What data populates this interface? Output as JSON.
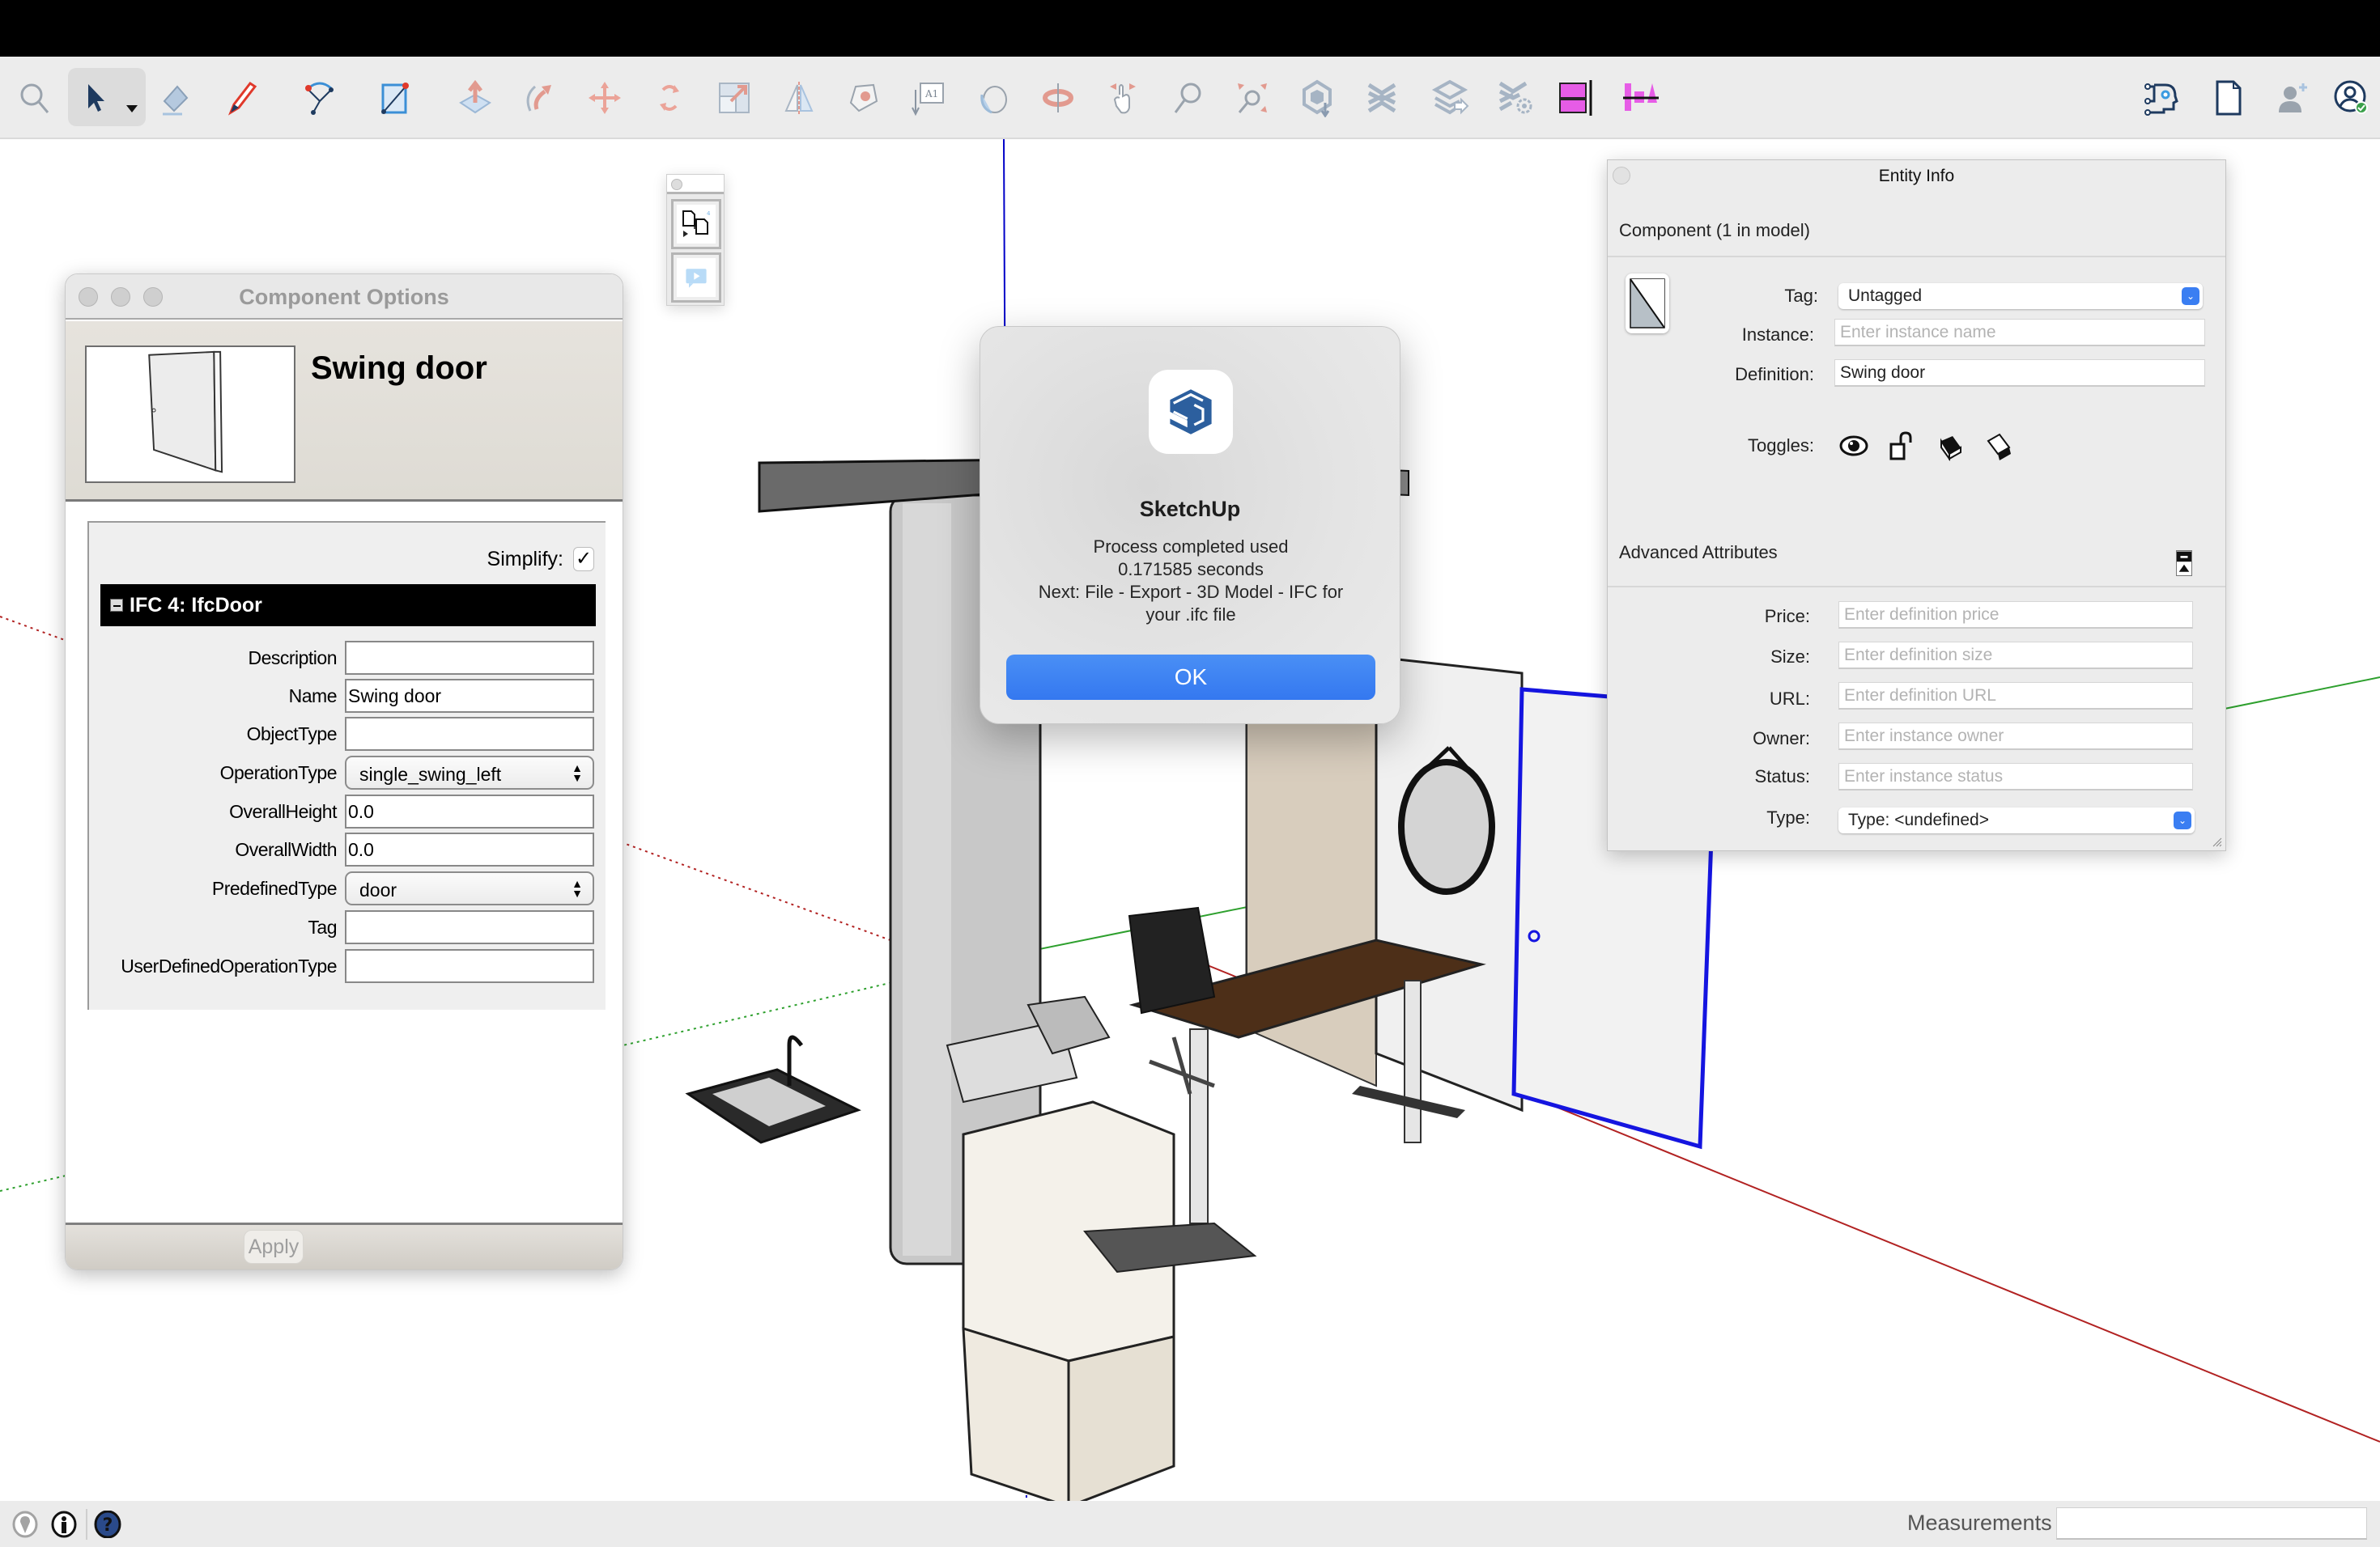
{
  "app": {
    "name": "SketchUp"
  },
  "toolbar": {
    "tools": [
      {
        "name": "search",
        "icon": "magnifier-icon"
      },
      {
        "name": "select",
        "icon": "select-arrow-icon",
        "selected": true,
        "has_dropdown": true
      },
      {
        "name": "eraser",
        "icon": "eraser-icon"
      },
      {
        "name": "pencil",
        "icon": "pencil-icon",
        "has_dropdown": true
      },
      {
        "name": "arc",
        "icon": "arc-icon",
        "has_dropdown": true
      },
      {
        "name": "rectangle",
        "icon": "rectangle-icon",
        "has_dropdown": true
      },
      {
        "name": "push-pull",
        "icon": "push-pull-icon"
      },
      {
        "name": "follow-me",
        "icon": "follow-me-icon"
      },
      {
        "name": "move",
        "icon": "move-icon"
      },
      {
        "name": "rotate",
        "icon": "rotate-icon"
      },
      {
        "name": "scale",
        "icon": "scale-icon"
      },
      {
        "name": "flip",
        "icon": "flip-icon"
      },
      {
        "name": "offset",
        "icon": "offset-icon"
      },
      {
        "name": "text",
        "icon": "text-icon"
      },
      {
        "name": "paint-bucket",
        "icon": "paint-bucket-icon"
      },
      {
        "name": "orbit",
        "icon": "orbit-icon"
      },
      {
        "name": "pan",
        "icon": "pan-hand-icon"
      },
      {
        "name": "zoom",
        "icon": "zoom-icon"
      },
      {
        "name": "zoom-extents",
        "icon": "zoom-extents-icon"
      },
      {
        "name": "3d-warehouse",
        "icon": "warehouse-icon"
      },
      {
        "name": "extension-warehouse",
        "icon": "extension-warehouse-icon"
      },
      {
        "name": "layers-export",
        "icon": "layer-export-icon"
      },
      {
        "name": "extension-manager",
        "icon": "extension-manager-icon"
      },
      {
        "name": "plugin-a",
        "icon": "magenta-panel-icon"
      },
      {
        "name": "plugin-b",
        "icon": "magenta-align-icon"
      }
    ],
    "right_tools": [
      {
        "name": "ai-assistant",
        "icon": "ai-head-icon"
      },
      {
        "name": "new-file",
        "icon": "document-icon"
      },
      {
        "name": "add-user",
        "icon": "add-user-icon"
      },
      {
        "name": "account",
        "icon": "account-verified-icon"
      }
    ]
  },
  "component_options": {
    "window_title": "Component Options",
    "component_name": "Swing door",
    "simplify_label": "Simplify:",
    "simplify_checked": true,
    "simplify_mark": "✓",
    "section_title": "IFC 4: IfcDoor",
    "fields": [
      {
        "label": "Description",
        "type": "text",
        "value": ""
      },
      {
        "label": "Name",
        "type": "text",
        "value": "Swing door"
      },
      {
        "label": "ObjectType",
        "type": "text",
        "value": ""
      },
      {
        "label": "OperationType",
        "type": "select",
        "value": "single_swing_left"
      },
      {
        "label": "OverallHeight",
        "type": "text",
        "value": "0.0"
      },
      {
        "label": "OverallWidth",
        "type": "text",
        "value": "0.0"
      },
      {
        "label": "PredefinedType",
        "type": "select",
        "value": "door"
      },
      {
        "label": "Tag",
        "type": "text",
        "value": ""
      },
      {
        "label": "UserDefinedOperationType",
        "type": "text",
        "value": ""
      }
    ],
    "apply_label": "Apply"
  },
  "alert": {
    "title": "SketchUp",
    "message_lines": [
      "Process completed used",
      "0.171585 seconds",
      "Next: File - Export - 3D Model - IFC for",
      "your .ifc file"
    ],
    "ok_label": "OK"
  },
  "entity_info": {
    "window_title": "Entity Info",
    "component_summary": "Component (1 in model)",
    "tag_label": "Tag:",
    "tag_value": "Untagged",
    "instance_label": "Instance:",
    "instance_placeholder": "Enter instance name",
    "instance_value": "",
    "definition_label": "Definition:",
    "definition_value": "Swing door",
    "toggles_label": "Toggles:",
    "toggles": [
      {
        "name": "visibility",
        "icon": "eye-icon"
      },
      {
        "name": "lock",
        "icon": "unlock-icon"
      },
      {
        "name": "receive-shadows",
        "icon": "receive-shadows-icon"
      },
      {
        "name": "cast-shadows",
        "icon": "cast-shadows-icon"
      }
    ],
    "advanced_title": "Advanced Attributes",
    "advanced_fields": [
      {
        "label": "Price:",
        "placeholder": "Enter definition price",
        "value": ""
      },
      {
        "label": "Size:",
        "placeholder": "Enter definition size",
        "value": ""
      },
      {
        "label": "URL:",
        "placeholder": "Enter definition URL",
        "value": ""
      },
      {
        "label": "Owner:",
        "placeholder": "Enter instance owner",
        "value": ""
      },
      {
        "label": "Status:",
        "placeholder": "Enter instance status",
        "value": ""
      }
    ],
    "type_label": "Type:",
    "type_value": "Type: <undefined>"
  },
  "statusbar": {
    "icons": [
      "geolocation-icon",
      "credits-info-icon",
      "help-icon"
    ],
    "measurements_label": "Measurements",
    "measurements_value": ""
  },
  "colors": {
    "accent_blue": "#3478f0",
    "axis_red": "#b22222",
    "axis_green": "#2ea02e",
    "axis_blue": "#0000c8",
    "plugin_magenta": "#e65ce6",
    "logo_blue": "#2c5f9e"
  }
}
